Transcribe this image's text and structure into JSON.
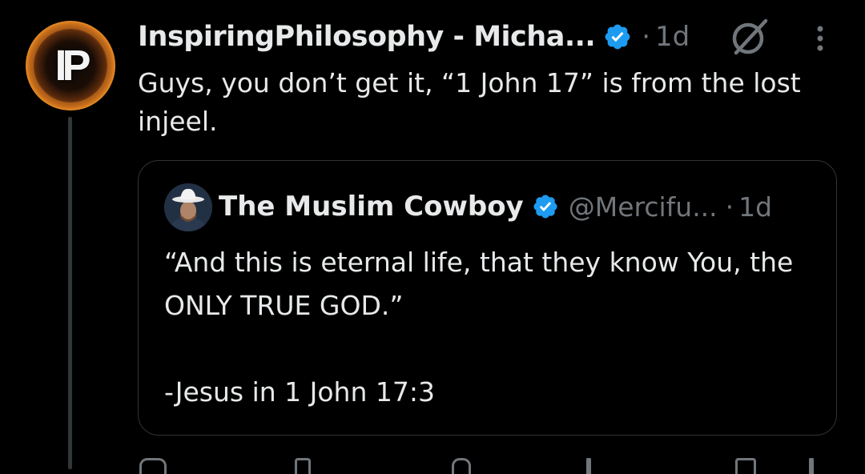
{
  "tweet": {
    "author_display_name": "InspiringPhilosophy - Micha...",
    "avatar_initials": "IP",
    "separator": "·",
    "time_ago": "1d",
    "text": "Guys, you don’t get it, “1 John 17” is from the lost injeel."
  },
  "quote": {
    "author_display_name": "The Muslim Cowboy",
    "handle": "@Mercifu...",
    "separator": "·",
    "time_ago": "1d",
    "text": "“And this is eternal life, that they know You, the ONLY TRUE GOD.”\n\n-Jesus in  1 John 17:3"
  },
  "icons": {
    "verified": "verified-badge-icon",
    "grok": "grok-icon",
    "more": "more-options-icon"
  },
  "colors": {
    "background": "#000000",
    "text_primary": "#e7e9ea",
    "text_secondary": "#71767b",
    "verified_blue": "#1d9bf0",
    "border": "#2f3336"
  }
}
